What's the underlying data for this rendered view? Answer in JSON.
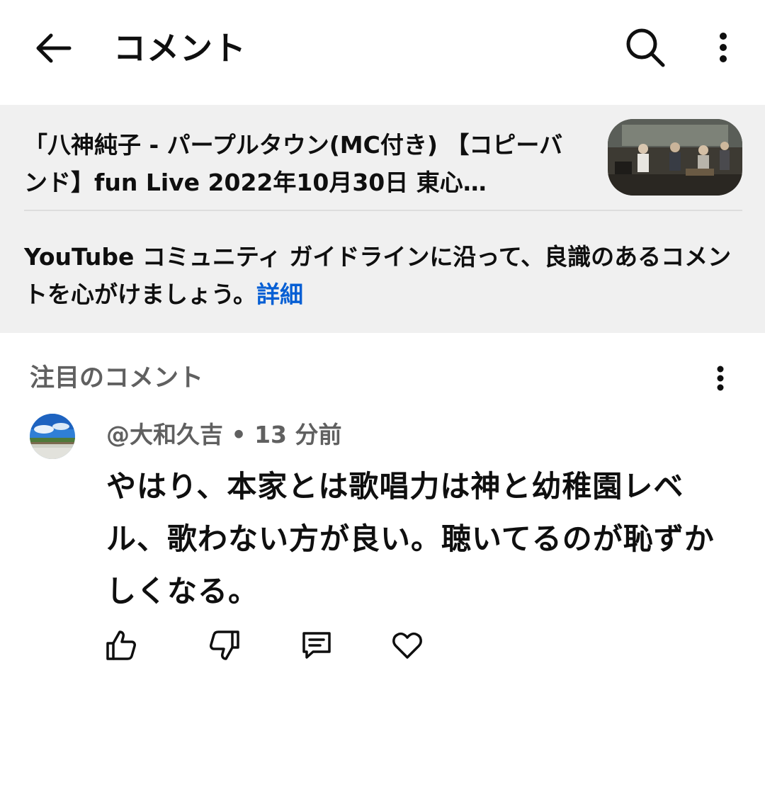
{
  "header": {
    "title": "コメント",
    "back_icon": "arrow-left-icon",
    "search_icon": "search-icon",
    "more_icon": "more-vert-icon"
  },
  "video": {
    "title": "「八神純子 - パープルタウン(MC付き) 【コピーバンド】fun Live 2022年10月30日 東心…",
    "thumbnail_icon": "video-thumbnail"
  },
  "guideline": {
    "text": "YouTube コミュニティ ガイドラインに沿って、良識のあるコメントを心がけましょう。",
    "link_label": "詳細"
  },
  "comments_section": {
    "header": "注目のコメント",
    "more_icon": "more-vert-icon"
  },
  "comment": {
    "author": "@大和久吉",
    "separator": " • ",
    "time": "13 分前",
    "text": "やはり、本家とは歌唱力は神と幼稚園レベル、歌わない方が良い。聴いてるのが恥ずかしくなる。",
    "avatar_icon": "avatar"
  },
  "actions": {
    "like_icon": "thumb-up-icon",
    "dislike_icon": "thumb-down-icon",
    "reply_icon": "reply-comment-icon",
    "heart_icon": "heart-icon"
  },
  "colors": {
    "link": "#065fd4",
    "secondary_text": "#606060",
    "section_bg": "#f0f0f0"
  }
}
